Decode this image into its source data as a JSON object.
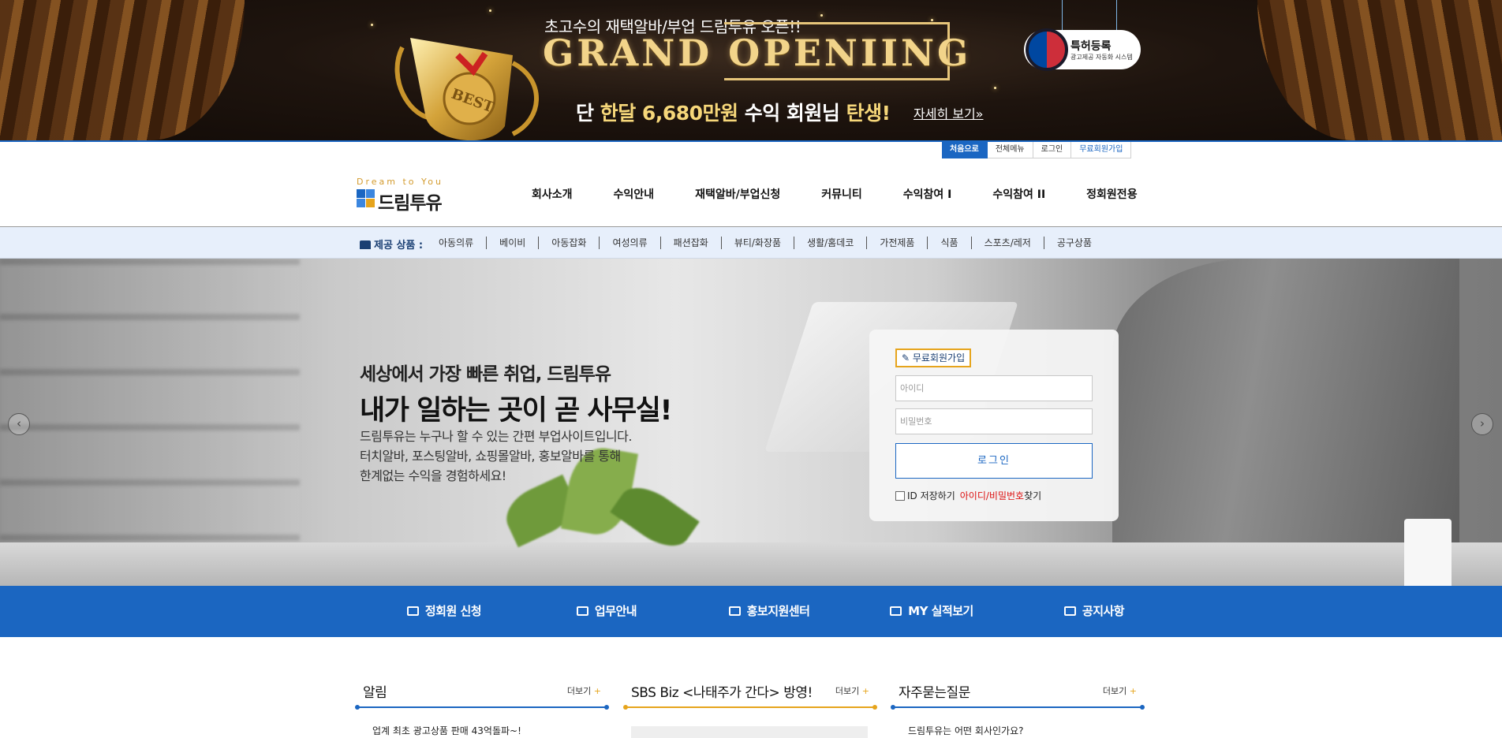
{
  "banner": {
    "sub": "초고수의 재택알바/부업 드림투유 오픈!!",
    "title": "GRAND OPENIING",
    "line_pre": "단 ",
    "line_gold": "한달 6,680만원",
    "line_mid": " 수익 회원님 ",
    "line_gold2": "탄생!",
    "more": "자세히 보기»",
    "trophy_text": "BEST",
    "patent_title": "특허등록",
    "patent_sub": "광고제공 자동화 시스템"
  },
  "toplinks": [
    "처음으로",
    "전체메뉴",
    "로그인",
    "무료회원가입"
  ],
  "logo": {
    "en": "Dream to You",
    "ko": "드림투유"
  },
  "nav": [
    "회사소개",
    "수익안내",
    "재택알바/부업신청",
    "커뮤니티",
    "수익참여 I",
    "수익참여 II",
    "정회원전용"
  ],
  "categories": {
    "label": "제공 상품 :",
    "items": [
      "아동의류",
      "베이비",
      "아동잡화",
      "여성의류",
      "패션잡화",
      "뷰티/화장품",
      "생활/홈데코",
      "가전제품",
      "식품",
      "스포츠/레저",
      "공구상품"
    ]
  },
  "hero": {
    "line1": "세상에서 가장 빠른 취업, 드림투유",
    "line2": "내가 일하는 곳이 곧 사무실!",
    "p1": "드림투유는 누구나 할 수 있는 간편 부업사이트입니다.",
    "p2": "터치알바, 포스팅알바, 쇼핑몰알바, 홍보알바를 통해",
    "p3": "한계없는 수익을 경험하세요!",
    "prev": "‹",
    "next": "›"
  },
  "login": {
    "join": "무료회원가입",
    "id_placeholder": "아이디",
    "pw_placeholder": "비밀번호",
    "submit": "로그인",
    "save_id": "ID 저장하기",
    "find_red": "아이디/비밀번호",
    "find_suffix": "찾기"
  },
  "quick": [
    "정회원 신청",
    "업무안내",
    "홍보지원센터",
    "MY 실적보기",
    "공지사항"
  ],
  "boards": [
    {
      "title": "알림",
      "more": "더보기",
      "item": "업계 최초 광고상품 판매 43억돌파~!",
      "color": "#1b66c1"
    },
    {
      "title": "SBS Biz <나태주가 간다> 방영!",
      "more": "더보기",
      "item": "",
      "color": "#e6a41c"
    },
    {
      "title": "자주묻는질문",
      "more": "더보기",
      "item": "드림투유는 어떤 회사인가요?",
      "color": "#1b66c1"
    }
  ],
  "colors": {
    "primary": "#1b66c1",
    "accent": "#e6a41c",
    "gold": "#f2d48a",
    "red": "#dd1111"
  }
}
